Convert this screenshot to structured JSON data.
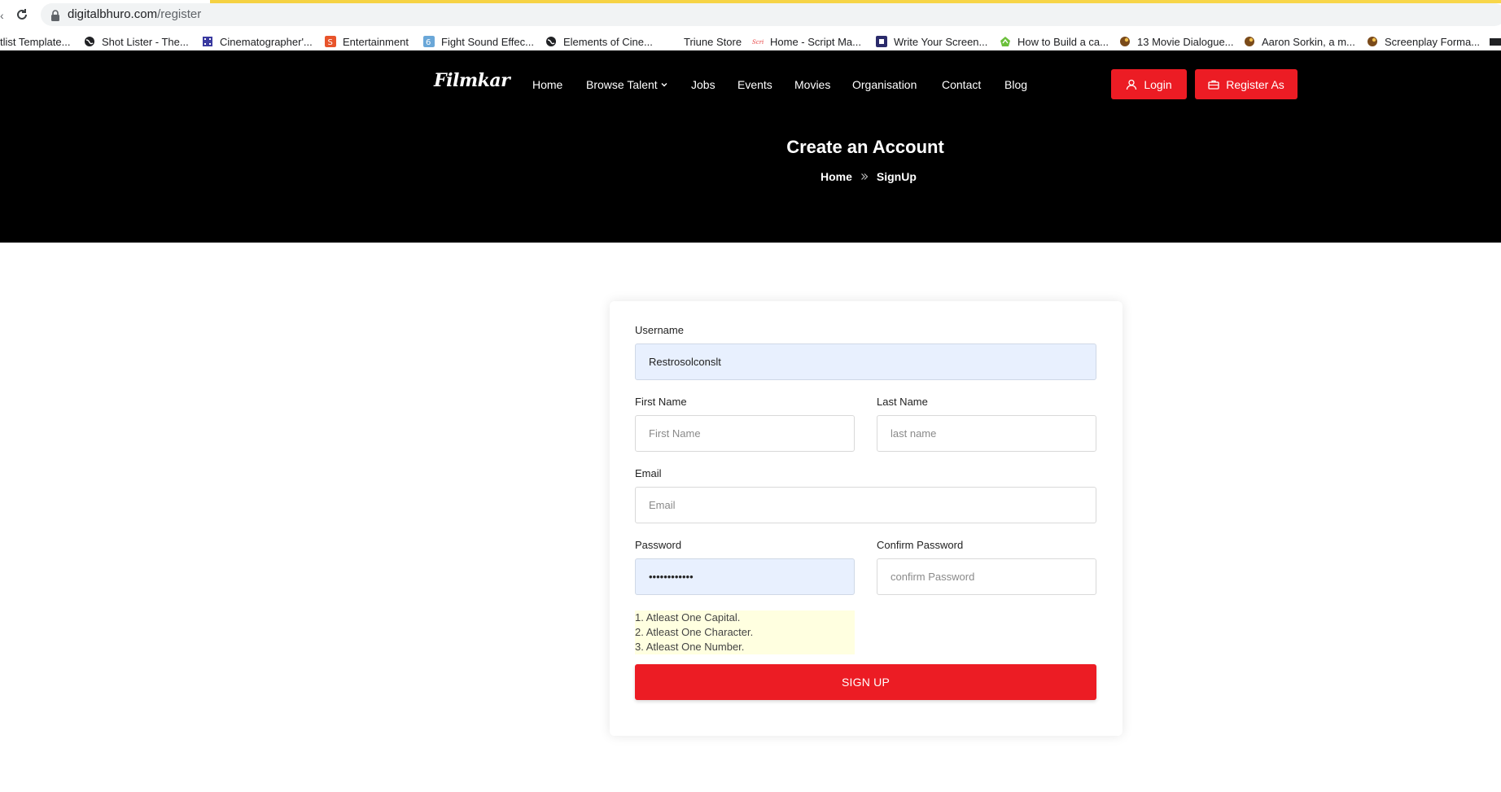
{
  "browser": {
    "url_domain": "digitalbhuro.com",
    "url_path": "/register",
    "bookmarks": [
      {
        "label": "tlist Template...",
        "icon": "none",
        "color": ""
      },
      {
        "label": "Shot Lister - The...",
        "icon": "globe-icon",
        "color": "#202124"
      },
      {
        "label": "Cinematographer'...",
        "icon": "film-icon",
        "color": "#3a3aa0"
      },
      {
        "label": "Entertainment",
        "icon": "s-icon",
        "color": "#e8542b"
      },
      {
        "label": "Fight Sound Effec...",
        "icon": "g-icon",
        "color": "#6aa7d8"
      },
      {
        "label": "Elements of Cine...",
        "icon": "globe-icon",
        "color": "#202124"
      },
      {
        "label": "Triune Store",
        "icon": "none",
        "color": ""
      },
      {
        "label": "Home - Script Ma...",
        "icon": "script-icon",
        "color": "#e84545"
      },
      {
        "label": "Write Your Screen...",
        "icon": "square-icon",
        "color": "#2b2b6b"
      },
      {
        "label": "How to Build a ca...",
        "icon": "leaf-icon",
        "color": "#6bbf3b"
      },
      {
        "label": "13 Movie Dialogue...",
        "icon": "bird-icon",
        "color": "#7a4a1a"
      },
      {
        "label": "Aaron Sorkin, a m...",
        "icon": "bird-icon",
        "color": "#7a4a1a"
      },
      {
        "label": "Screenplay Forma...",
        "icon": "bird-icon",
        "color": "#7a4a1a"
      }
    ]
  },
  "header": {
    "logo": "Filmkar",
    "nav": [
      "Home",
      "Browse Talent",
      "Jobs",
      "Events",
      "Movies",
      "Organisation",
      "Contact",
      "Blog"
    ],
    "login_label": "Login",
    "register_label": "Register As",
    "accent": "#ec1c24"
  },
  "hero": {
    "title": "Create an Account",
    "breadcrumb_home": "Home",
    "breadcrumb_current": "SignUp"
  },
  "form": {
    "username_label": "Username",
    "username_value": "Restrosolconslt",
    "first_name_label": "First Name",
    "first_name_placeholder": "First Name",
    "last_name_label": "Last Name",
    "last_name_placeholder": "last name",
    "email_label": "Email",
    "email_placeholder": "Email",
    "password_label": "Password",
    "password_value": "••••••••••••",
    "confirm_label": "Confirm Password",
    "confirm_placeholder": "confirm Password",
    "hints": [
      "1. Atleast One Capital.",
      "2. Atleast One Character.",
      "3. Atleast One Number."
    ],
    "submit_label": "SIGN UP"
  }
}
